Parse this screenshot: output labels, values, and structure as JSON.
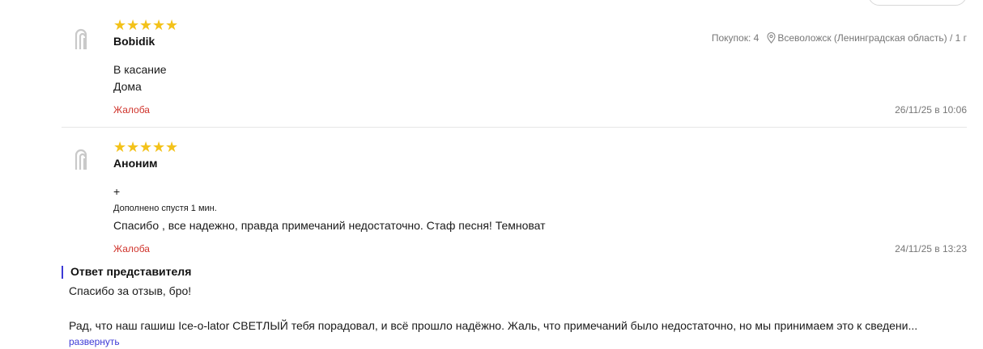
{
  "reviews": [
    {
      "rating": 5,
      "author": "Bobidik",
      "purchases_label": "Покупок: 4",
      "location": "Всеволожск (Ленинградская область) / 1 г",
      "lines": [
        "В касание",
        "Дома"
      ],
      "complaint_label": "Жалоба",
      "date": "26/11/25 в 10:06"
    },
    {
      "rating": 5,
      "author": "Аноним",
      "first_line": "+",
      "addendum_note": "Дополнено спустя 1 мин.",
      "addendum_text": "Спасибо , все надежно, правда примечаний недостаточно. Стаф песня! Темноват",
      "complaint_label": "Жалоба",
      "date": "24/11/25 в 13:23"
    }
  ],
  "reply": {
    "title": "Ответ представителя",
    "line1": "Спасибо за отзыв, бро!",
    "line2": "Рад, что наш гашиш Ice-o-lator СВЕТЛЫЙ тебя порадовал, и всё прошло надёжно. Жаль, что примечаний было недостаточно, но мы принимаем это к сведени...",
    "expand_label": "развернуть"
  },
  "colors": {
    "star": "#f3c21a",
    "complaint": "#d0342c",
    "accent": "#3d3ad6",
    "muted": "#777777"
  },
  "icons": [
    "avatar-placeholder-icon",
    "star-icon",
    "location-pin-icon"
  ]
}
